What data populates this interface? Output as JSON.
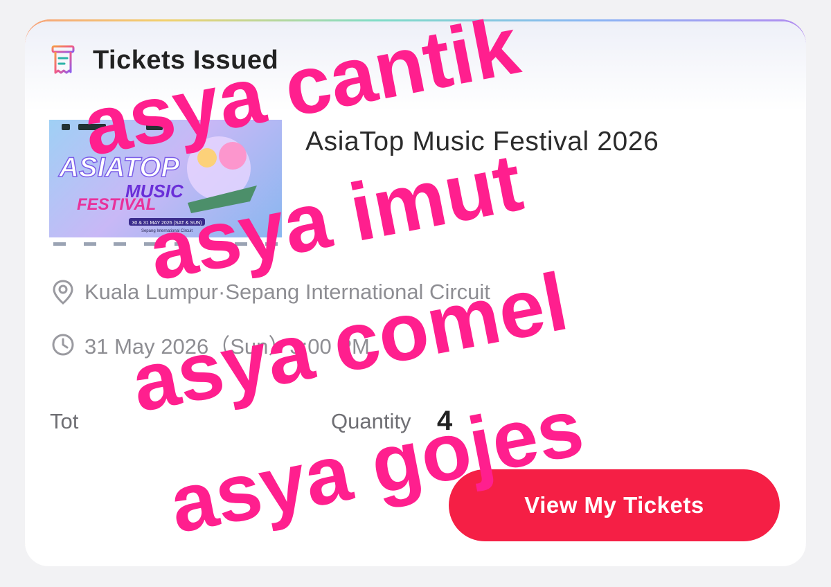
{
  "header": {
    "title": "Tickets Issued",
    "icon": "ticket-receipt-icon"
  },
  "event": {
    "title": "AsiaTop Music Festival 2026",
    "location": "Kuala Lumpur·Sepang International Circuit",
    "datetime": "31 May 2026（Sun）3:00 PM"
  },
  "poster": {
    "line1": "ASIATOP",
    "line2": "MUSIC",
    "line3": "FESTIVAL",
    "dates": "30 & 31 MAY 2026 (SAT & SUN)",
    "venue": "Sepang International Circuit"
  },
  "stats": {
    "total_label": "Tot",
    "quantity_label": "Quantity",
    "quantity_value": "4"
  },
  "actions": {
    "view_tickets_label": "View My Tickets"
  },
  "overlay": {
    "line1": "asya cantik",
    "line2": "asya imut",
    "line3": "asya comel",
    "line4": "asya gojes",
    "color": "#ff1f8e"
  },
  "colors": {
    "accent": "#f51f45",
    "muted_text": "#8e8e93"
  }
}
